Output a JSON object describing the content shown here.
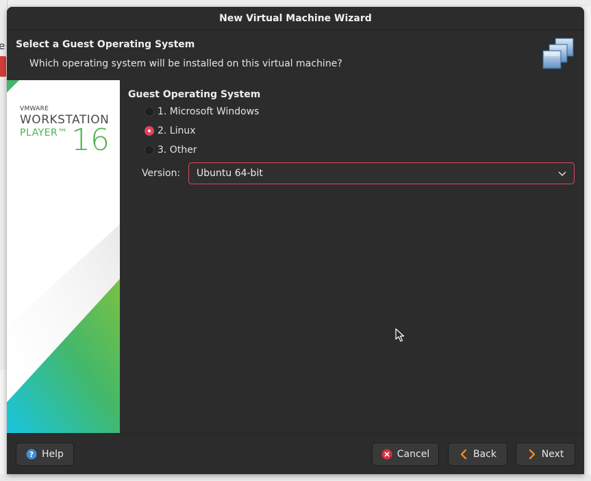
{
  "window": {
    "title": "New Virtual Machine Wizard"
  },
  "header": {
    "title": "Select a Guest Operating System",
    "subtitle": "Which operating system will be installed on this virtual machine?",
    "icon": "vm-stack-icon"
  },
  "banner": {
    "brand_small": "VMWARE",
    "brand_product": "WORKSTATION",
    "brand_edition": "PLAYER™",
    "brand_version": "16",
    "colors": {
      "green": "#4bb24b",
      "teal": "#1fc2d8",
      "text": "#4a4a4a"
    }
  },
  "guest_os": {
    "group_title": "Guest Operating System",
    "options": [
      {
        "label": "1. Microsoft Windows",
        "checked": false
      },
      {
        "label": "2. Linux",
        "checked": true
      },
      {
        "label": "3. Other",
        "checked": false
      }
    ],
    "version_label": "Version:",
    "version_value": "Ubuntu 64-bit"
  },
  "footer": {
    "help_label": "Help",
    "cancel_label": "Cancel",
    "back_label": "Back",
    "next_label": "Next"
  },
  "colors": {
    "accent": "#e0445a",
    "window_bg": "#2c2c2c",
    "button_bg": "#393939"
  },
  "background_fragment": {
    "text": "e"
  }
}
